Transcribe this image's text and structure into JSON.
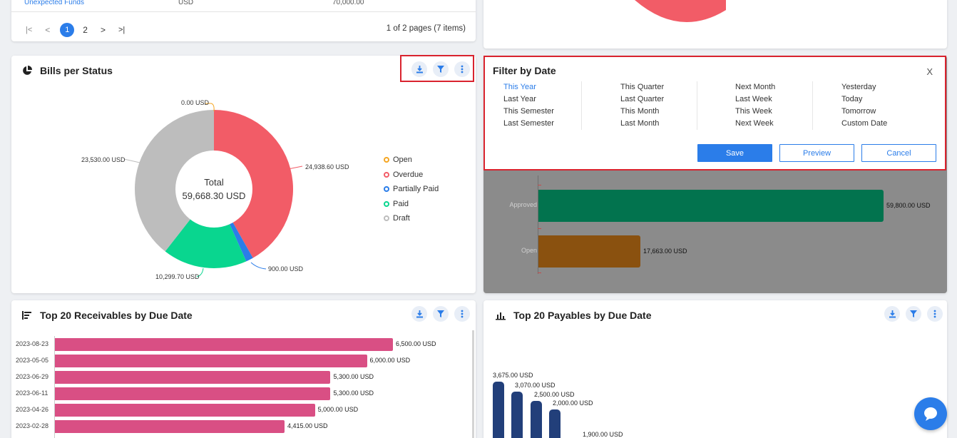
{
  "top_left": {
    "partial_row": [
      "Unexpected Funds",
      "USD",
      "70,000.00"
    ],
    "pagination": {
      "pages": [
        "1",
        "2"
      ],
      "info": "1 of 2 pages (7 items)"
    }
  },
  "bills": {
    "title": "Bills per Status",
    "total_label": "Total",
    "total_value": "59,668.30 USD",
    "slice_labels": {
      "open": "0.00 USD",
      "overdue": "24,938.60 USD",
      "partially_paid": "900.00 USD",
      "paid": "10,299.70 USD",
      "draft": "23,530.00 USD"
    },
    "legend": [
      {
        "label": "Open",
        "color": "#f5a623"
      },
      {
        "label": "Overdue",
        "color": "#f25c67"
      },
      {
        "label": "Partially Paid",
        "color": "#2b7de9"
      },
      {
        "label": "Paid",
        "color": "#09d68f"
      },
      {
        "label": "Draft",
        "color": "#bdbdbd"
      }
    ]
  },
  "filter": {
    "title": "Filter by Date",
    "close": "X",
    "columns": [
      [
        "This Year",
        "Last Year",
        "This Semester",
        "Last Semester"
      ],
      [
        "This Quarter",
        "Last Quarter",
        "This Month",
        "Last Month"
      ],
      [
        "Next Month",
        "Last Week",
        "This Week",
        "Next Week"
      ],
      [
        "Yesterday",
        "Today",
        "Tomorrow",
        "Custom Date"
      ]
    ],
    "save": "Save",
    "preview": "Preview",
    "cancel": "Cancel"
  },
  "approved_chart": {
    "bars": [
      {
        "label": "Approved",
        "value": "59,800.00 USD"
      },
      {
        "label": "Open",
        "value": "17,663.00 USD"
      }
    ]
  },
  "receivables": {
    "title": "Top 20 Receivables by Due Date",
    "rows": [
      {
        "date": "2023-08-23",
        "value": "6,500.00 USD"
      },
      {
        "date": "2023-05-05",
        "value": "6,000.00 USD"
      },
      {
        "date": "2023-06-29",
        "value": "5,300.00 USD"
      },
      {
        "date": "2023-06-11",
        "value": "5,300.00 USD"
      },
      {
        "date": "2023-04-26",
        "value": "5,000.00 USD"
      },
      {
        "date": "2023-02-28",
        "value": "4,415.00 USD"
      }
    ]
  },
  "payables": {
    "title": "Top 20 Payables by Due Date",
    "labels": [
      "3,675.00 USD",
      "3,070.00 USD",
      "2,500.00 USD",
      "2,000.00 USD",
      "1,900.00 USD"
    ]
  },
  "colors": {
    "accent": "#2b7de9",
    "outline": "#d9232e"
  },
  "chart_data": [
    {
      "type": "pie",
      "title": "Bills per Status",
      "categories": [
        "Open",
        "Overdue",
        "Partially Paid",
        "Paid",
        "Draft"
      ],
      "values": [
        0.0,
        24938.6,
        900.0,
        10299.7,
        23530.0
      ]
    },
    {
      "type": "bar",
      "categories": [
        "Approved",
        "Open"
      ],
      "values": [
        59800.0,
        17663.0
      ]
    },
    {
      "type": "bar",
      "title": "Top 20 Receivables by Due Date",
      "categories": [
        "2023-08-23",
        "2023-05-05",
        "2023-06-29",
        "2023-06-11",
        "2023-04-26",
        "2023-02-28"
      ],
      "values": [
        6500,
        6000,
        5300,
        5300,
        5000,
        4415
      ]
    },
    {
      "type": "bar",
      "title": "Top 20 Payables by Due Date",
      "values": [
        3675,
        3070,
        2500,
        2000,
        1900
      ]
    }
  ]
}
